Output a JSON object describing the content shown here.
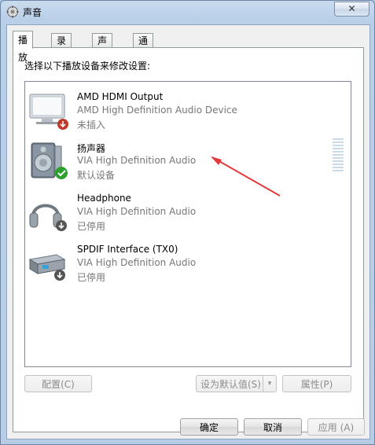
{
  "window": {
    "title": "声音",
    "close_symbol": "✕"
  },
  "tabs": [
    {
      "label": "播放",
      "active": true
    },
    {
      "label": "录制",
      "active": false
    },
    {
      "label": "声音",
      "active": false
    },
    {
      "label": "通信",
      "active": false
    }
  ],
  "panel": {
    "instruction": "选择以下播放设备来修改设置:"
  },
  "devices": [
    {
      "name": "AMD HDMI Output",
      "description": "AMD High Definition Audio Device",
      "status": "未插入",
      "icon": "monitor-icon",
      "badge": "unplugged-badge-icon"
    },
    {
      "name": "扬声器",
      "description": "VIA High Definition Audio",
      "status": "默认设备",
      "icon": "speaker-icon",
      "badge": "default-check-icon"
    },
    {
      "name": "Headphone",
      "description": "VIA High Definition Audio",
      "status": "已停用",
      "icon": "headphone-icon",
      "badge": "disabled-badge-icon"
    },
    {
      "name": "SPDIF Interface (TX0)",
      "description": "VIA High Definition Audio",
      "status": "已停用",
      "icon": "spdif-device-icon",
      "badge": "disabled-badge-icon"
    }
  ],
  "panel_buttons": {
    "configure": "配置(C)",
    "set_default": "设为默认值(S)",
    "dropdown_symbol": "▾",
    "properties": "属性(P)"
  },
  "dialog_buttons": {
    "ok": "确定",
    "cancel": "取消",
    "apply": "应用 (A)"
  },
  "colors": {
    "accent_arrow": "#e23b3b",
    "check_green": "#2ca02c"
  }
}
